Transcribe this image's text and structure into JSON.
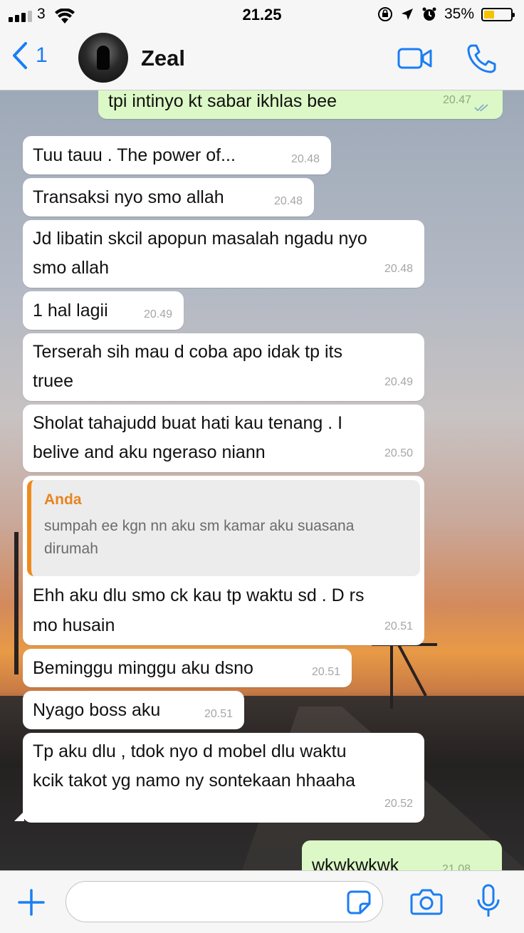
{
  "status_bar": {
    "carrier": "3",
    "time": "21.25",
    "battery": "35%"
  },
  "header": {
    "back_count": "1",
    "contact_name": "Zeal"
  },
  "messages": [
    {
      "dir": "out",
      "text": "tpi intinyo kt sabar ikhlas bee",
      "time": "20.47"
    },
    {
      "dir": "in",
      "text": "Tuu tauu . The power of...",
      "time": "20.48"
    },
    {
      "dir": "in",
      "text": "Transaksi nyo smo allah",
      "time": "20.48"
    },
    {
      "dir": "in",
      "line1": "Jd libatin skcil apopun masalah ngadu nyo",
      "line2": "smo allah",
      "time": "20.48"
    },
    {
      "dir": "in",
      "text": "1 hal lagii",
      "time": "20.49"
    },
    {
      "dir": "in",
      "line1": "Terserah sih mau d coba apo idak tp its",
      "line2": "truee",
      "time": "20.49"
    },
    {
      "dir": "in",
      "line1": "Sholat tahajudd buat hati kau tenang . I",
      "line2": "belive and aku ngeraso  niann",
      "time": "20.50"
    },
    {
      "dir": "in",
      "quote_name": "Anda",
      "quote_line1": "sumpah ee kgn nn aku sm kamar aku suasana",
      "quote_line2": "dirumah",
      "line1": "Ehh aku dlu smo ck kau tp waktu sd . D rs",
      "line2": "mo husain",
      "time": "20.51"
    },
    {
      "dir": "in",
      "text": "Beminggu minggu aku dsno",
      "time": "20.51"
    },
    {
      "dir": "in",
      "text": "Nyago boss aku",
      "time": "20.51"
    },
    {
      "dir": "in",
      "line1": "Tp aku dlu , tdok nyo d mobel dlu waktu",
      "line2": "kcik takot yg namo ny sontekaan hhaaha",
      "time": "20.52"
    },
    {
      "dir": "out",
      "text": "wkwkwkwk",
      "time": "21.08"
    }
  ],
  "input": {
    "placeholder": ""
  },
  "colors": {
    "accent": "#1a7ef2",
    "outgoing": "#dcf8c6",
    "quote_bar": "#f08a1c"
  }
}
